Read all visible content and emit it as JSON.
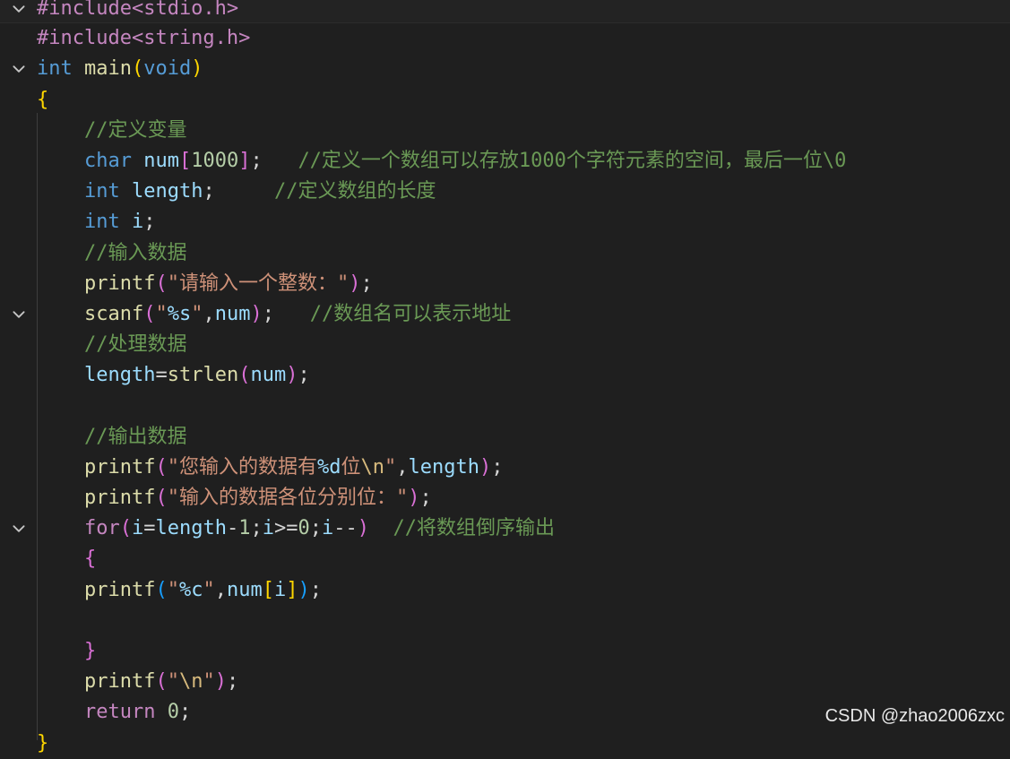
{
  "editor": {
    "lines": [
      {
        "fold": true,
        "current": true,
        "tokens": [
          {
            "t": "#include<stdio.h>",
            "c": "pre"
          }
        ]
      },
      {
        "fold": false,
        "tokens": [
          {
            "t": "#include<string.h>",
            "c": "pre"
          }
        ]
      },
      {
        "fold": true,
        "tokens": [
          {
            "t": "int",
            "c": "kw"
          },
          {
            "t": " ",
            "c": "op"
          },
          {
            "t": "main",
            "c": "fn"
          },
          {
            "t": "(",
            "c": "b1"
          },
          {
            "t": "void",
            "c": "kw"
          },
          {
            "t": ")",
            "c": "b1"
          }
        ]
      },
      {
        "fold": false,
        "tokens": [
          {
            "t": "{",
            "c": "b1"
          }
        ]
      },
      {
        "fold": false,
        "tokens": [
          {
            "t": "    //定义变量",
            "c": "com"
          }
        ]
      },
      {
        "fold": false,
        "tokens": [
          {
            "t": "    ",
            "c": "op"
          },
          {
            "t": "char",
            "c": "kw"
          },
          {
            "t": " ",
            "c": "op"
          },
          {
            "t": "num",
            "c": "var"
          },
          {
            "t": "[",
            "c": "b2"
          },
          {
            "t": "1000",
            "c": "num"
          },
          {
            "t": "]",
            "c": "b2"
          },
          {
            "t": ";   ",
            "c": "op"
          },
          {
            "t": "//定义一个数组可以存放1000个字符元素的空间，最后一位\\0",
            "c": "com"
          }
        ]
      },
      {
        "fold": false,
        "tokens": [
          {
            "t": "    ",
            "c": "op"
          },
          {
            "t": "int",
            "c": "kw"
          },
          {
            "t": " ",
            "c": "op"
          },
          {
            "t": "length",
            "c": "var"
          },
          {
            "t": ";     ",
            "c": "op"
          },
          {
            "t": "//定义数组的长度",
            "c": "com"
          }
        ]
      },
      {
        "fold": false,
        "tokens": [
          {
            "t": "    ",
            "c": "op"
          },
          {
            "t": "int",
            "c": "kw"
          },
          {
            "t": " ",
            "c": "op"
          },
          {
            "t": "i",
            "c": "var"
          },
          {
            "t": ";",
            "c": "op"
          }
        ]
      },
      {
        "fold": false,
        "tokens": [
          {
            "t": "    //输入数据",
            "c": "com"
          }
        ]
      },
      {
        "fold": false,
        "tokens": [
          {
            "t": "    ",
            "c": "op"
          },
          {
            "t": "printf",
            "c": "fn"
          },
          {
            "t": "(",
            "c": "b2"
          },
          {
            "t": "\"请输入一个整数：\"",
            "c": "str"
          },
          {
            "t": ")",
            "c": "b2"
          },
          {
            "t": ";",
            "c": "op"
          }
        ]
      },
      {
        "fold": true,
        "tokens": [
          {
            "t": "    ",
            "c": "op"
          },
          {
            "t": "scanf",
            "c": "fn"
          },
          {
            "t": "(",
            "c": "b2"
          },
          {
            "t": "\"",
            "c": "str"
          },
          {
            "t": "%s",
            "c": "fmt"
          },
          {
            "t": "\"",
            "c": "str"
          },
          {
            "t": ",",
            "c": "op"
          },
          {
            "t": "num",
            "c": "var"
          },
          {
            "t": ")",
            "c": "b2"
          },
          {
            "t": ";   ",
            "c": "op"
          },
          {
            "t": "//数组名可以表示地址",
            "c": "com"
          }
        ]
      },
      {
        "fold": false,
        "tokens": [
          {
            "t": "    //处理数据",
            "c": "com"
          }
        ]
      },
      {
        "fold": false,
        "tokens": [
          {
            "t": "    ",
            "c": "op"
          },
          {
            "t": "length",
            "c": "var"
          },
          {
            "t": "=",
            "c": "op"
          },
          {
            "t": "strlen",
            "c": "fn"
          },
          {
            "t": "(",
            "c": "b2"
          },
          {
            "t": "num",
            "c": "var"
          },
          {
            "t": ")",
            "c": "b2"
          },
          {
            "t": ";",
            "c": "op"
          }
        ]
      },
      {
        "fold": false,
        "tokens": []
      },
      {
        "fold": false,
        "tokens": [
          {
            "t": "    //输出数据",
            "c": "com"
          }
        ]
      },
      {
        "fold": false,
        "tokens": [
          {
            "t": "    ",
            "c": "op"
          },
          {
            "t": "printf",
            "c": "fn"
          },
          {
            "t": "(",
            "c": "b2"
          },
          {
            "t": "\"您输入的数据有",
            "c": "str"
          },
          {
            "t": "%d",
            "c": "fmt"
          },
          {
            "t": "位",
            "c": "str"
          },
          {
            "t": "\\n",
            "c": "esc"
          },
          {
            "t": "\"",
            "c": "str"
          },
          {
            "t": ",",
            "c": "op"
          },
          {
            "t": "length",
            "c": "var"
          },
          {
            "t": ")",
            "c": "b2"
          },
          {
            "t": ";",
            "c": "op"
          }
        ]
      },
      {
        "fold": false,
        "tokens": [
          {
            "t": "    ",
            "c": "op"
          },
          {
            "t": "printf",
            "c": "fn"
          },
          {
            "t": "(",
            "c": "b2"
          },
          {
            "t": "\"输入的数据各位分别位：\"",
            "c": "str"
          },
          {
            "t": ")",
            "c": "b2"
          },
          {
            "t": ";",
            "c": "op"
          }
        ]
      },
      {
        "fold": true,
        "tokens": [
          {
            "t": "    ",
            "c": "op"
          },
          {
            "t": "for",
            "c": "ctl"
          },
          {
            "t": "(",
            "c": "b2"
          },
          {
            "t": "i",
            "c": "var"
          },
          {
            "t": "=",
            "c": "op"
          },
          {
            "t": "length",
            "c": "var"
          },
          {
            "t": "-",
            "c": "op"
          },
          {
            "t": "1",
            "c": "num"
          },
          {
            "t": ";",
            "c": "op"
          },
          {
            "t": "i",
            "c": "var"
          },
          {
            "t": ">=",
            "c": "op"
          },
          {
            "t": "0",
            "c": "num"
          },
          {
            "t": ";",
            "c": "op"
          },
          {
            "t": "i",
            "c": "var"
          },
          {
            "t": "--",
            "c": "op"
          },
          {
            "t": ")",
            "c": "b2"
          },
          {
            "t": "  ",
            "c": "op"
          },
          {
            "t": "//将数组倒序输出",
            "c": "com"
          }
        ]
      },
      {
        "fold": false,
        "tokens": [
          {
            "t": "    ",
            "c": "op"
          },
          {
            "t": "{",
            "c": "b2"
          }
        ]
      },
      {
        "fold": false,
        "tokens": [
          {
            "t": "    ",
            "c": "op"
          },
          {
            "t": "printf",
            "c": "fn"
          },
          {
            "t": "(",
            "c": "b3"
          },
          {
            "t": "\"",
            "c": "str"
          },
          {
            "t": "%c",
            "c": "fmt"
          },
          {
            "t": "\"",
            "c": "str"
          },
          {
            "t": ",",
            "c": "op"
          },
          {
            "t": "num",
            "c": "var"
          },
          {
            "t": "[",
            "c": "b1"
          },
          {
            "t": "i",
            "c": "var"
          },
          {
            "t": "]",
            "c": "b1"
          },
          {
            "t": ")",
            "c": "b3"
          },
          {
            "t": ";",
            "c": "op"
          }
        ]
      },
      {
        "fold": false,
        "tokens": []
      },
      {
        "fold": false,
        "tokens": [
          {
            "t": "    ",
            "c": "op"
          },
          {
            "t": "}",
            "c": "b2"
          }
        ]
      },
      {
        "fold": false,
        "tokens": [
          {
            "t": "    ",
            "c": "op"
          },
          {
            "t": "printf",
            "c": "fn"
          },
          {
            "t": "(",
            "c": "b2"
          },
          {
            "t": "\"",
            "c": "str"
          },
          {
            "t": "\\n",
            "c": "esc"
          },
          {
            "t": "\"",
            "c": "str"
          },
          {
            "t": ")",
            "c": "b2"
          },
          {
            "t": ";",
            "c": "op"
          }
        ]
      },
      {
        "fold": false,
        "tokens": [
          {
            "t": "    ",
            "c": "op"
          },
          {
            "t": "return",
            "c": "ctl"
          },
          {
            "t": " ",
            "c": "op"
          },
          {
            "t": "0",
            "c": "num"
          },
          {
            "t": ";",
            "c": "op"
          }
        ]
      },
      {
        "fold": false,
        "tokens": [
          {
            "t": "}",
            "c": "b1"
          }
        ]
      }
    ]
  },
  "watermark": "CSDN @zhao2006zxc",
  "icons": {
    "fold": "chevron-down-icon"
  }
}
